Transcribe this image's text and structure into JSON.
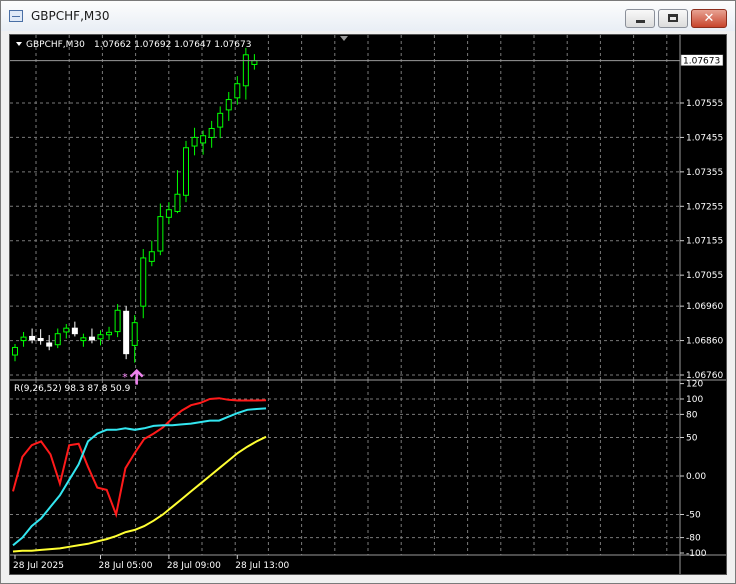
{
  "window": {
    "title": "GBPCHF,M30"
  },
  "colors": {
    "bull": "#00ff00",
    "bear": "#ffffff",
    "grid": "#7a7a7a",
    "background": "#000000",
    "arrow": "#ee82ee"
  },
  "chart": {
    "symbol_header": "GBPCHF,M30",
    "ohlc": "1.07662 1.07692 1.07647 1.07673",
    "current_price": "1.07673",
    "price_ticks": [
      {
        "value": 1.0755,
        "label": "1.07555"
      },
      {
        "value": 1.0745,
        "label": "1.07455"
      },
      {
        "value": 1.0735,
        "label": "1.07355"
      },
      {
        "value": 1.0725,
        "label": "1.07255"
      },
      {
        "value": 1.0715,
        "label": "1.07155"
      },
      {
        "value": 1.0705,
        "label": "1.07055"
      },
      {
        "value": 1.0696,
        "label": "1.06960"
      },
      {
        "value": 1.0686,
        "label": "1.06860"
      },
      {
        "value": 1.0676,
        "label": "1.06760"
      }
    ],
    "time_labels": [
      {
        "index": 0,
        "label": "28 Jul 2025"
      },
      {
        "index": 10,
        "label": "28 Jul 05:00"
      },
      {
        "index": 18,
        "label": "28 Jul 09:00"
      },
      {
        "index": 26,
        "label": "28 Jul 13:00"
      }
    ]
  },
  "indicator": {
    "header": "R(9,26,52) 98.3 87.8 50.9",
    "ticks": [
      {
        "value": 120,
        "label": "120"
      },
      {
        "value": 100,
        "label": "100"
      },
      {
        "value": 80,
        "label": "80"
      },
      {
        "value": 50,
        "label": "50"
      },
      {
        "value": 0,
        "label": "0.00"
      },
      {
        "value": -50,
        "label": "-50"
      },
      {
        "value": -80,
        "label": "-80"
      },
      {
        "value": -100,
        "label": "-100"
      }
    ]
  },
  "chart_data": {
    "type": "candlestick",
    "symbol": "GBPCHF",
    "timeframe": "M30",
    "candles": [
      {
        "o": 1.06818,
        "h": 1.0685,
        "l": 1.068,
        "c": 1.0684
      },
      {
        "o": 1.0686,
        "h": 1.06885,
        "l": 1.06842,
        "c": 1.0687
      },
      {
        "o": 1.06872,
        "h": 1.06895,
        "l": 1.06852,
        "c": 1.06862
      },
      {
        "o": 1.06866,
        "h": 1.06893,
        "l": 1.06848,
        "c": 1.0686
      },
      {
        "o": 1.06853,
        "h": 1.06876,
        "l": 1.06832,
        "c": 1.06844
      },
      {
        "o": 1.06848,
        "h": 1.06895,
        "l": 1.06838,
        "c": 1.0688
      },
      {
        "o": 1.06885,
        "h": 1.06908,
        "l": 1.06866,
        "c": 1.06896
      },
      {
        "o": 1.06896,
        "h": 1.06915,
        "l": 1.06872,
        "c": 1.0688
      },
      {
        "o": 1.0686,
        "h": 1.0688,
        "l": 1.06842,
        "c": 1.06868
      },
      {
        "o": 1.0687,
        "h": 1.06895,
        "l": 1.06852,
        "c": 1.06862
      },
      {
        "o": 1.06865,
        "h": 1.0689,
        "l": 1.06846,
        "c": 1.06877
      },
      {
        "o": 1.06877,
        "h": 1.069,
        "l": 1.06862,
        "c": 1.06884
      },
      {
        "o": 1.06886,
        "h": 1.06966,
        "l": 1.0687,
        "c": 1.06948
      },
      {
        "o": 1.06945,
        "h": 1.0696,
        "l": 1.06806,
        "c": 1.06822
      },
      {
        "o": 1.06846,
        "h": 1.06934,
        "l": 1.06796,
        "c": 1.06912
      },
      {
        "o": 1.0696,
        "h": 1.07126,
        "l": 1.06925,
        "c": 1.071
      },
      {
        "o": 1.0709,
        "h": 1.0715,
        "l": 1.07076,
        "c": 1.07118
      },
      {
        "o": 1.0712,
        "h": 1.07258,
        "l": 1.07108,
        "c": 1.0722
      },
      {
        "o": 1.07218,
        "h": 1.07262,
        "l": 1.07198,
        "c": 1.0724
      },
      {
        "o": 1.07235,
        "h": 1.07355,
        "l": 1.0723,
        "c": 1.07285
      },
      {
        "o": 1.07282,
        "h": 1.0744,
        "l": 1.07262,
        "c": 1.0742
      },
      {
        "o": 1.07425,
        "h": 1.07478,
        "l": 1.07398,
        "c": 1.0745
      },
      {
        "o": 1.07434,
        "h": 1.0747,
        "l": 1.074,
        "c": 1.07455
      },
      {
        "o": 1.0745,
        "h": 1.07498,
        "l": 1.0742,
        "c": 1.07476
      },
      {
        "o": 1.0748,
        "h": 1.0754,
        "l": 1.07448,
        "c": 1.0752
      },
      {
        "o": 1.0753,
        "h": 1.07582,
        "l": 1.07498,
        "c": 1.0756
      },
      {
        "o": 1.07565,
        "h": 1.07628,
        "l": 1.07545,
        "c": 1.07606
      },
      {
        "o": 1.076,
        "h": 1.0771,
        "l": 1.0756,
        "c": 1.0769
      },
      {
        "o": 1.07662,
        "h": 1.07692,
        "l": 1.07647,
        "c": 1.07673
      }
    ],
    "signal_arrow_index": 14,
    "signal_star_index": 13,
    "indicator": {
      "name": "R(9,26,52)",
      "ylim": [
        -100,
        120
      ],
      "series": [
        {
          "color": "#ff1a1a",
          "values": [
            -20,
            25,
            40,
            45,
            28,
            -10,
            40,
            42,
            12,
            -15,
            -18,
            -50,
            10,
            30,
            48,
            55,
            63,
            75,
            85,
            92,
            95,
            100,
            101,
            99,
            98,
            98,
            98,
            98.3
          ]
        },
        {
          "color": "#33e6f0",
          "values": [
            -90,
            -80,
            -65,
            -55,
            -40,
            -25,
            -5,
            15,
            45,
            55,
            60,
            60,
            62,
            60,
            62,
            65,
            66,
            66,
            67,
            68,
            70,
            72,
            72,
            77,
            82,
            86,
            87,
            87.8
          ]
        },
        {
          "color": "#ffff33",
          "values": [
            -98,
            -97,
            -97,
            -96,
            -95,
            -94,
            -92,
            -90,
            -88,
            -85,
            -82,
            -78,
            -73,
            -70,
            -65,
            -58,
            -50,
            -40,
            -30,
            -20,
            -10,
            0,
            10,
            20,
            30,
            38,
            45,
            50.9
          ]
        }
      ]
    }
  }
}
